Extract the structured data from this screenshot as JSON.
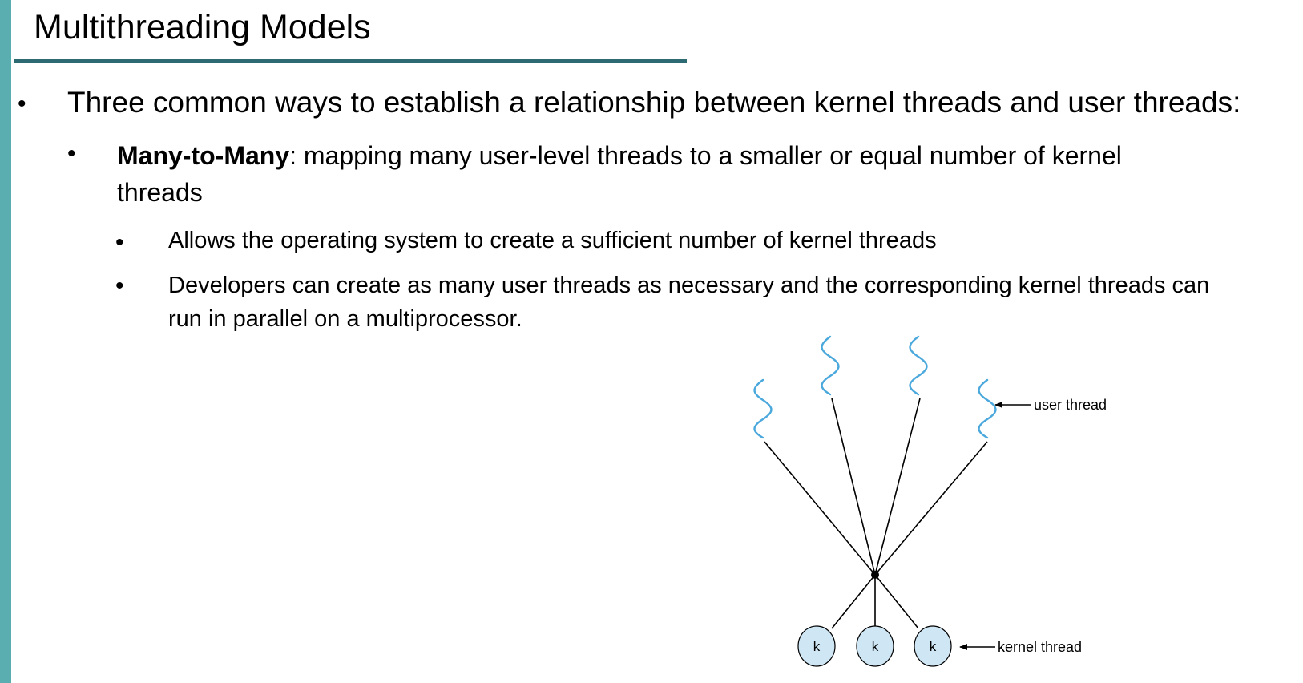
{
  "slide": {
    "title": "Multithreading Models",
    "bullets": {
      "main": "Three common ways to establish a relationship between kernel threads and user threads:",
      "model_name": "Many-to-Many",
      "model_desc_line1": ": mapping many user-level threads to a smaller or equal number of kernel",
      "model_desc_line2": "threads",
      "point1": "Allows the operating system to create a sufficient number of kernel threads",
      "point2_line1": "Developers can create as many user threads as necessary and the corresponding kernel threads can",
      "point2_line2": "run in parallel on a multiprocessor."
    },
    "bullet_glyph": "•"
  },
  "diagram": {
    "user_thread_label": "user thread",
    "kernel_thread_label": "kernel thread",
    "kernel_node_label": "k",
    "user_thread_color": "#4aa8dc",
    "kernel_fill": "#cfe6f5"
  }
}
